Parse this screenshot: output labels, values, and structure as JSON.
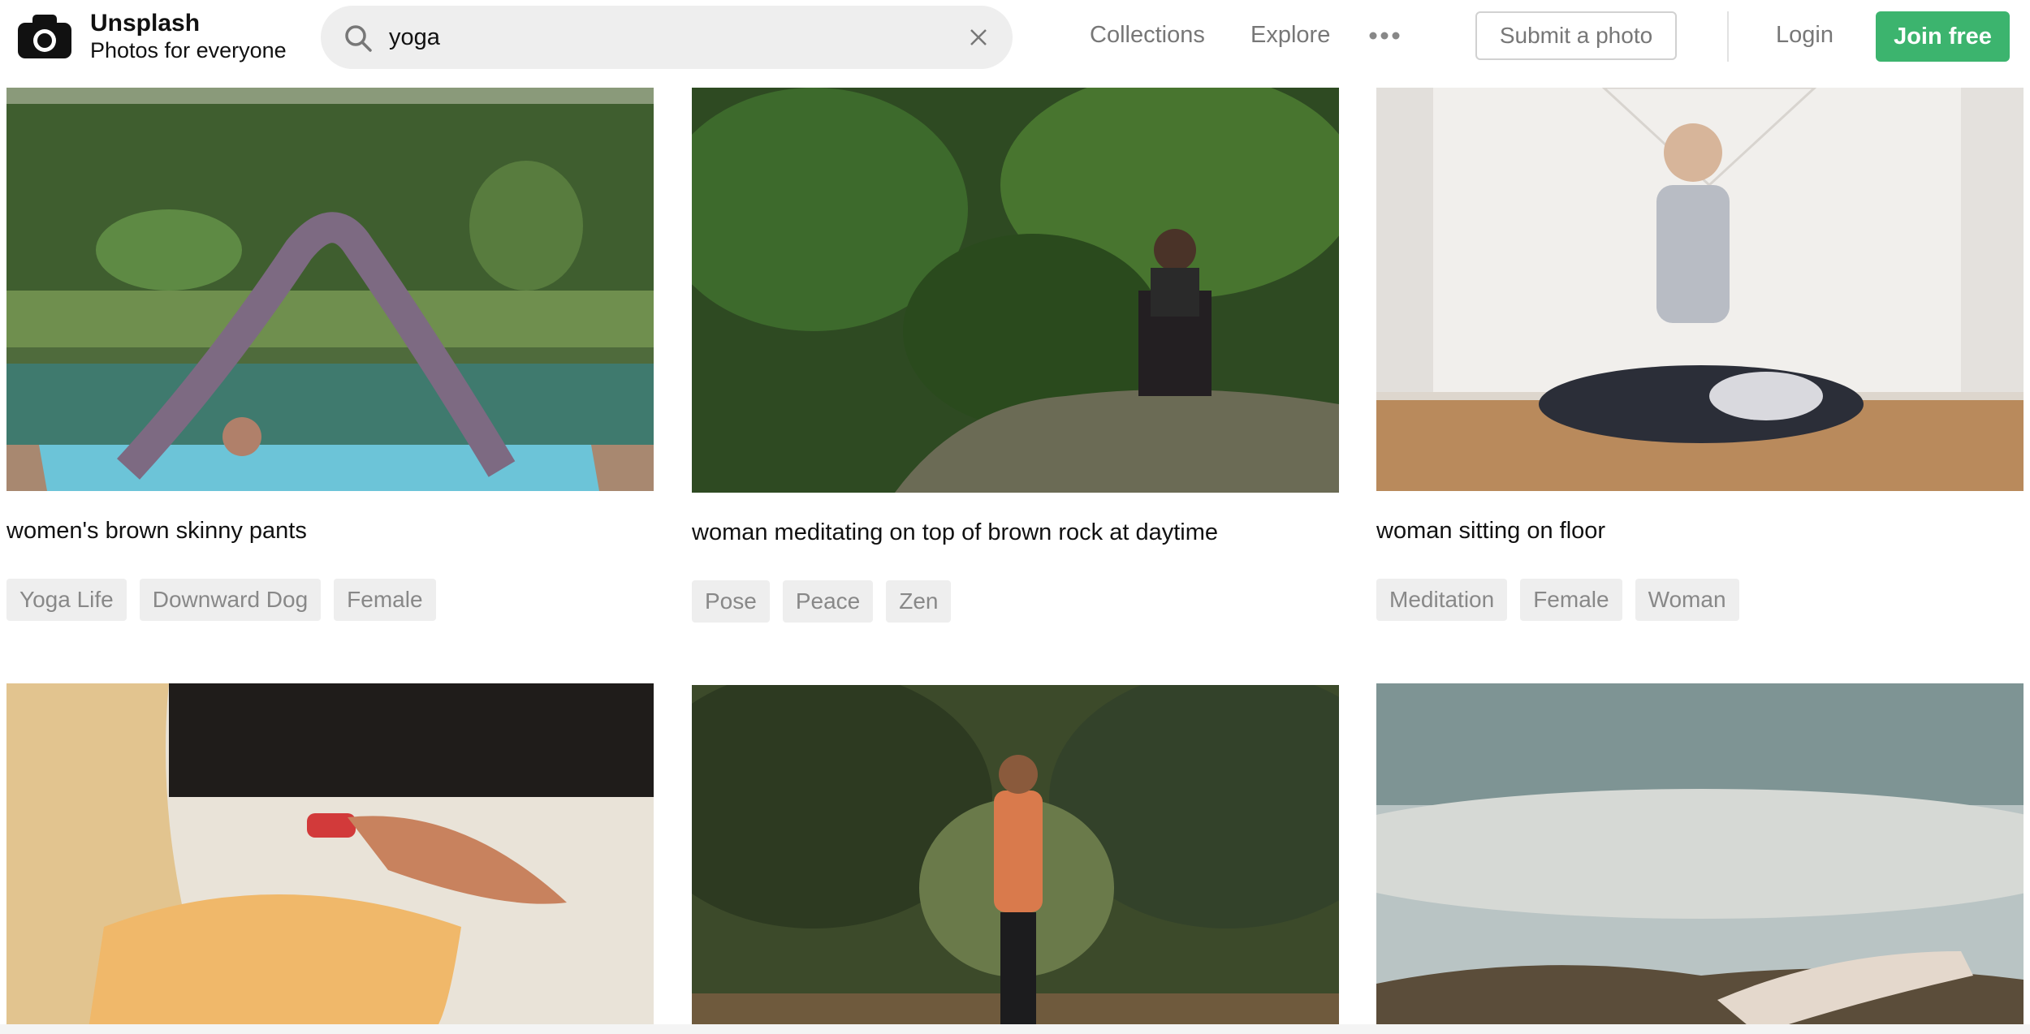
{
  "header": {
    "brand_title": "Unsplash",
    "brand_subtitle": "Photos for everyone",
    "search_value": "yoga",
    "nav": [
      "Collections",
      "Explore"
    ],
    "submit_label": "Submit a photo",
    "login_label": "Login",
    "join_label": "Join free",
    "accent_color": "#3cb46e",
    "icons": {
      "logo": "camera-icon",
      "search": "search-icon",
      "clear": "close-icon",
      "more": "more-dots-icon"
    }
  },
  "photos": [
    {
      "caption": "women's brown skinny pants",
      "tags": [
        "Yoga Life",
        "Downward Dog",
        "Female"
      ]
    },
    {
      "caption": "woman meditating on top of brown rock at daytime",
      "tags": [
        "Pose",
        "Peace",
        "Zen"
      ]
    },
    {
      "caption": "woman sitting on floor",
      "tags": [
        "Meditation",
        "Female",
        "Woman"
      ]
    },
    {
      "caption": "",
      "tags": []
    },
    {
      "caption": "",
      "tags": []
    },
    {
      "caption": "",
      "tags": []
    }
  ]
}
